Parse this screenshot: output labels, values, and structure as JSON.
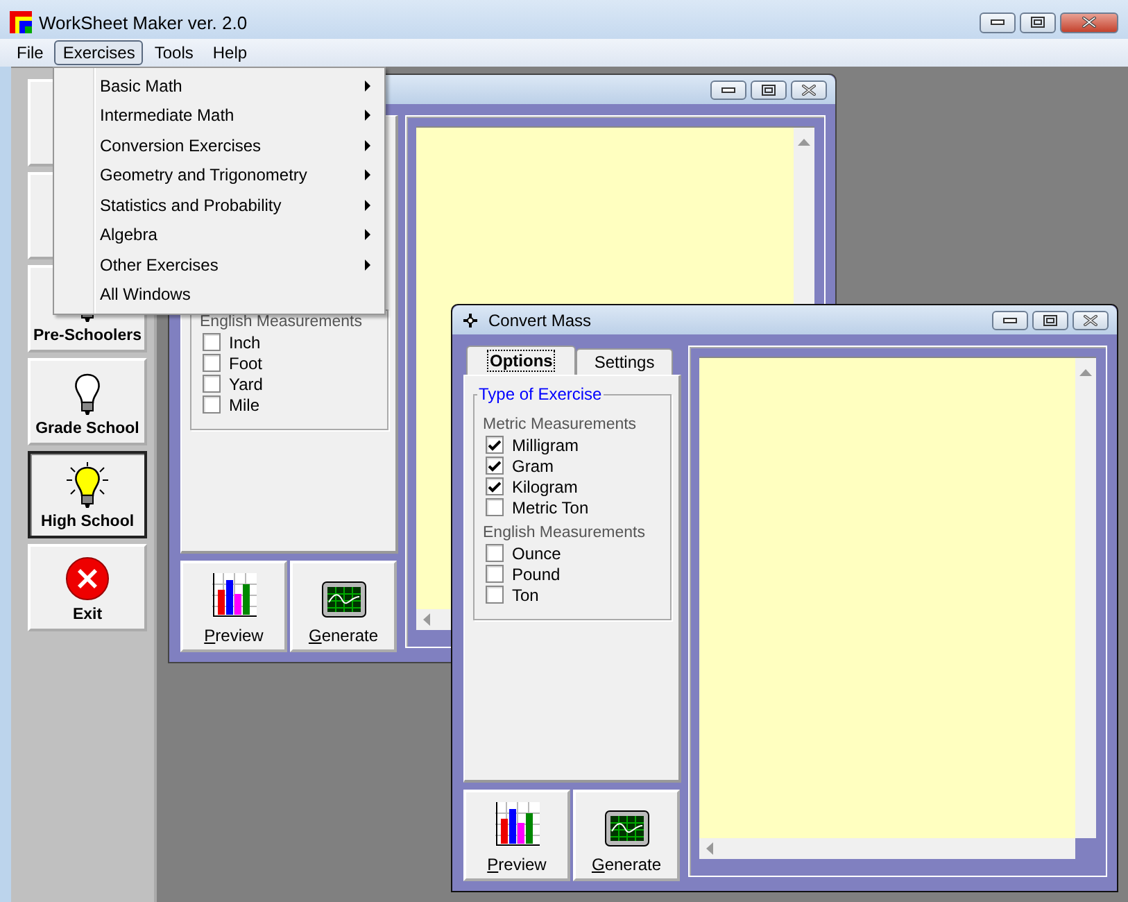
{
  "window": {
    "title": "WorkSheet Maker ver. 2.0"
  },
  "menu_bar": [
    {
      "label": "File",
      "selected": false
    },
    {
      "label": "Exercises",
      "selected": true
    },
    {
      "label": "Tools",
      "selected": false
    },
    {
      "label": "Help",
      "selected": false
    }
  ],
  "exercises_menu": [
    {
      "label": "Basic Math",
      "submenu": true
    },
    {
      "label": "Intermediate Math",
      "submenu": true
    },
    {
      "label": "Conversion Exercises",
      "submenu": true
    },
    {
      "label": "Geometry and Trigonometry",
      "submenu": true
    },
    {
      "label": "Statistics and Probability",
      "submenu": true
    },
    {
      "label": "Algebra",
      "submenu": true
    },
    {
      "label": "Other Exercises",
      "submenu": true
    },
    {
      "label": "All Windows",
      "submenu": false
    }
  ],
  "sidebar": {
    "items": [
      {
        "kind": "blank",
        "selected": false
      },
      {
        "kind": "blank",
        "selected": false
      },
      {
        "kind": "level",
        "label": "Pre-Schoolers",
        "selected": false
      },
      {
        "kind": "level",
        "label": "Grade School",
        "selected": false
      },
      {
        "kind": "level",
        "label": "High School",
        "selected": true
      },
      {
        "kind": "exit",
        "label": "Exit",
        "selected": false
      }
    ]
  },
  "back_window": {
    "sections": [
      {
        "heading": "English Measurements",
        "units": [
          {
            "label": "Inch",
            "checked": false
          },
          {
            "label": "Foot",
            "checked": false
          },
          {
            "label": "Yard",
            "checked": false
          },
          {
            "label": "Mile",
            "checked": false
          }
        ]
      }
    ],
    "buttons": [
      {
        "kind": "preview",
        "label": "Preview"
      },
      {
        "kind": "generate",
        "label": "Generate"
      }
    ]
  },
  "front_window": {
    "title": "Convert Mass",
    "tabs": [
      {
        "label": "Options",
        "selected": true
      },
      {
        "label": "Settings",
        "selected": false
      }
    ],
    "group_title": "Type of Exercise",
    "sections": [
      {
        "heading": "Metric Measurements",
        "units": [
          {
            "label": "Milligram",
            "checked": true
          },
          {
            "label": "Gram",
            "checked": true
          },
          {
            "label": "Kilogram",
            "checked": true
          },
          {
            "label": "Metric Ton",
            "checked": false
          }
        ]
      },
      {
        "heading": "English Measurements",
        "units": [
          {
            "label": "Ounce",
            "checked": false
          },
          {
            "label": "Pound",
            "checked": false
          },
          {
            "label": "Ton",
            "checked": false
          }
        ]
      }
    ],
    "buttons": [
      {
        "kind": "preview",
        "label": "Preview"
      },
      {
        "kind": "generate",
        "label": "Generate"
      }
    ]
  }
}
